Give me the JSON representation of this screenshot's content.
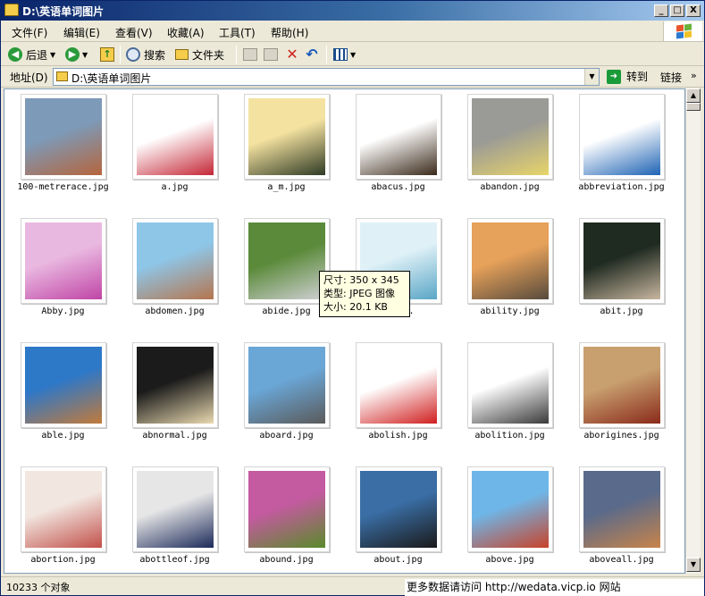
{
  "window": {
    "title": "D:\\英语单词图片",
    "minimize": "_",
    "maximize": "□",
    "close": "X"
  },
  "menu": [
    {
      "label": "文件(F)"
    },
    {
      "label": "编辑(E)"
    },
    {
      "label": "查看(V)"
    },
    {
      "label": "收藏(A)"
    },
    {
      "label": "工具(T)"
    },
    {
      "label": "帮助(H)"
    }
  ],
  "toolbar": {
    "back_label": "后退",
    "search_label": "搜索",
    "folders_label": "文件夹"
  },
  "address": {
    "label": "地址(D)",
    "value": "D:\\英语单词图片",
    "go_label": "转到",
    "links_label": "链接"
  },
  "files": [
    {
      "name": "100-metrerace.jpg",
      "c1": "#7d9ab8",
      "c2": "#b5653c"
    },
    {
      "name": "a.jpg",
      "c1": "#ffffff",
      "c2": "#c42636"
    },
    {
      "name": "a_m.jpg",
      "c1": "#f4e2a0",
      "c2": "#2f3a24"
    },
    {
      "name": "abacus.jpg",
      "c1": "#ffffff",
      "c2": "#3b2a1a"
    },
    {
      "name": "abandon.jpg",
      "c1": "#9a9a96",
      "c2": "#e8d56a"
    },
    {
      "name": "abbreviation.jpg",
      "c1": "#ffffff",
      "c2": "#1e63b4"
    },
    {
      "name": "Abby.jpg",
      "c1": "#e9b8e0",
      "c2": "#c045a6"
    },
    {
      "name": "abdomen.jpg",
      "c1": "#8ec6e8",
      "c2": "#b5754e"
    },
    {
      "name": "abide.jpg",
      "c1": "#5b8a3a",
      "c2": "#cfd0d3"
    },
    {
      "name": "abi...",
      "c1": "#dff1f7",
      "c2": "#5aa6c6"
    },
    {
      "name": "ability.jpg",
      "c1": "#e6a15a",
      "c2": "#574a3c"
    },
    {
      "name": "abit.jpg",
      "c1": "#1f2a20",
      "c2": "#c8b6a0"
    },
    {
      "name": "able.jpg",
      "c1": "#2e78c8",
      "c2": "#c27a3a"
    },
    {
      "name": "abnormal.jpg",
      "c1": "#1b1b1b",
      "c2": "#e9d9b0"
    },
    {
      "name": "aboard.jpg",
      "c1": "#6aa6d6",
      "c2": "#5a5a5a"
    },
    {
      "name": "abolish.jpg",
      "c1": "#ffffff",
      "c2": "#d01f1f"
    },
    {
      "name": "abolition.jpg",
      "c1": "#ffffff",
      "c2": "#3a3a3a"
    },
    {
      "name": "aborigines.jpg",
      "c1": "#c8a070",
      "c2": "#8a2a1a"
    },
    {
      "name": "abortion.jpg",
      "c1": "#f2e6e0",
      "c2": "#c2504a"
    },
    {
      "name": "abottleof.jpg",
      "c1": "#e6e6e6",
      "c2": "#1c2a5a"
    },
    {
      "name": "abound.jpg",
      "c1": "#c45aa0",
      "c2": "#5a8a2a"
    },
    {
      "name": "about.jpg",
      "c1": "#3a6ea5",
      "c2": "#1a1a1a"
    },
    {
      "name": "above.jpg",
      "c1": "#6fb6e8",
      "c2": "#c8432a"
    },
    {
      "name": "aboveall.jpg",
      "c1": "#5a6a8a",
      "c2": "#c8844a"
    }
  ],
  "tooltip": {
    "line1": "尺寸: 350 x 345",
    "line2": "类型: JPEG 图像",
    "line3": "大小: 20.1 KB"
  },
  "status": {
    "objects": "10233 个对象",
    "watermark": "更多数据请访问 http://wedata.vicp.io 网站"
  }
}
